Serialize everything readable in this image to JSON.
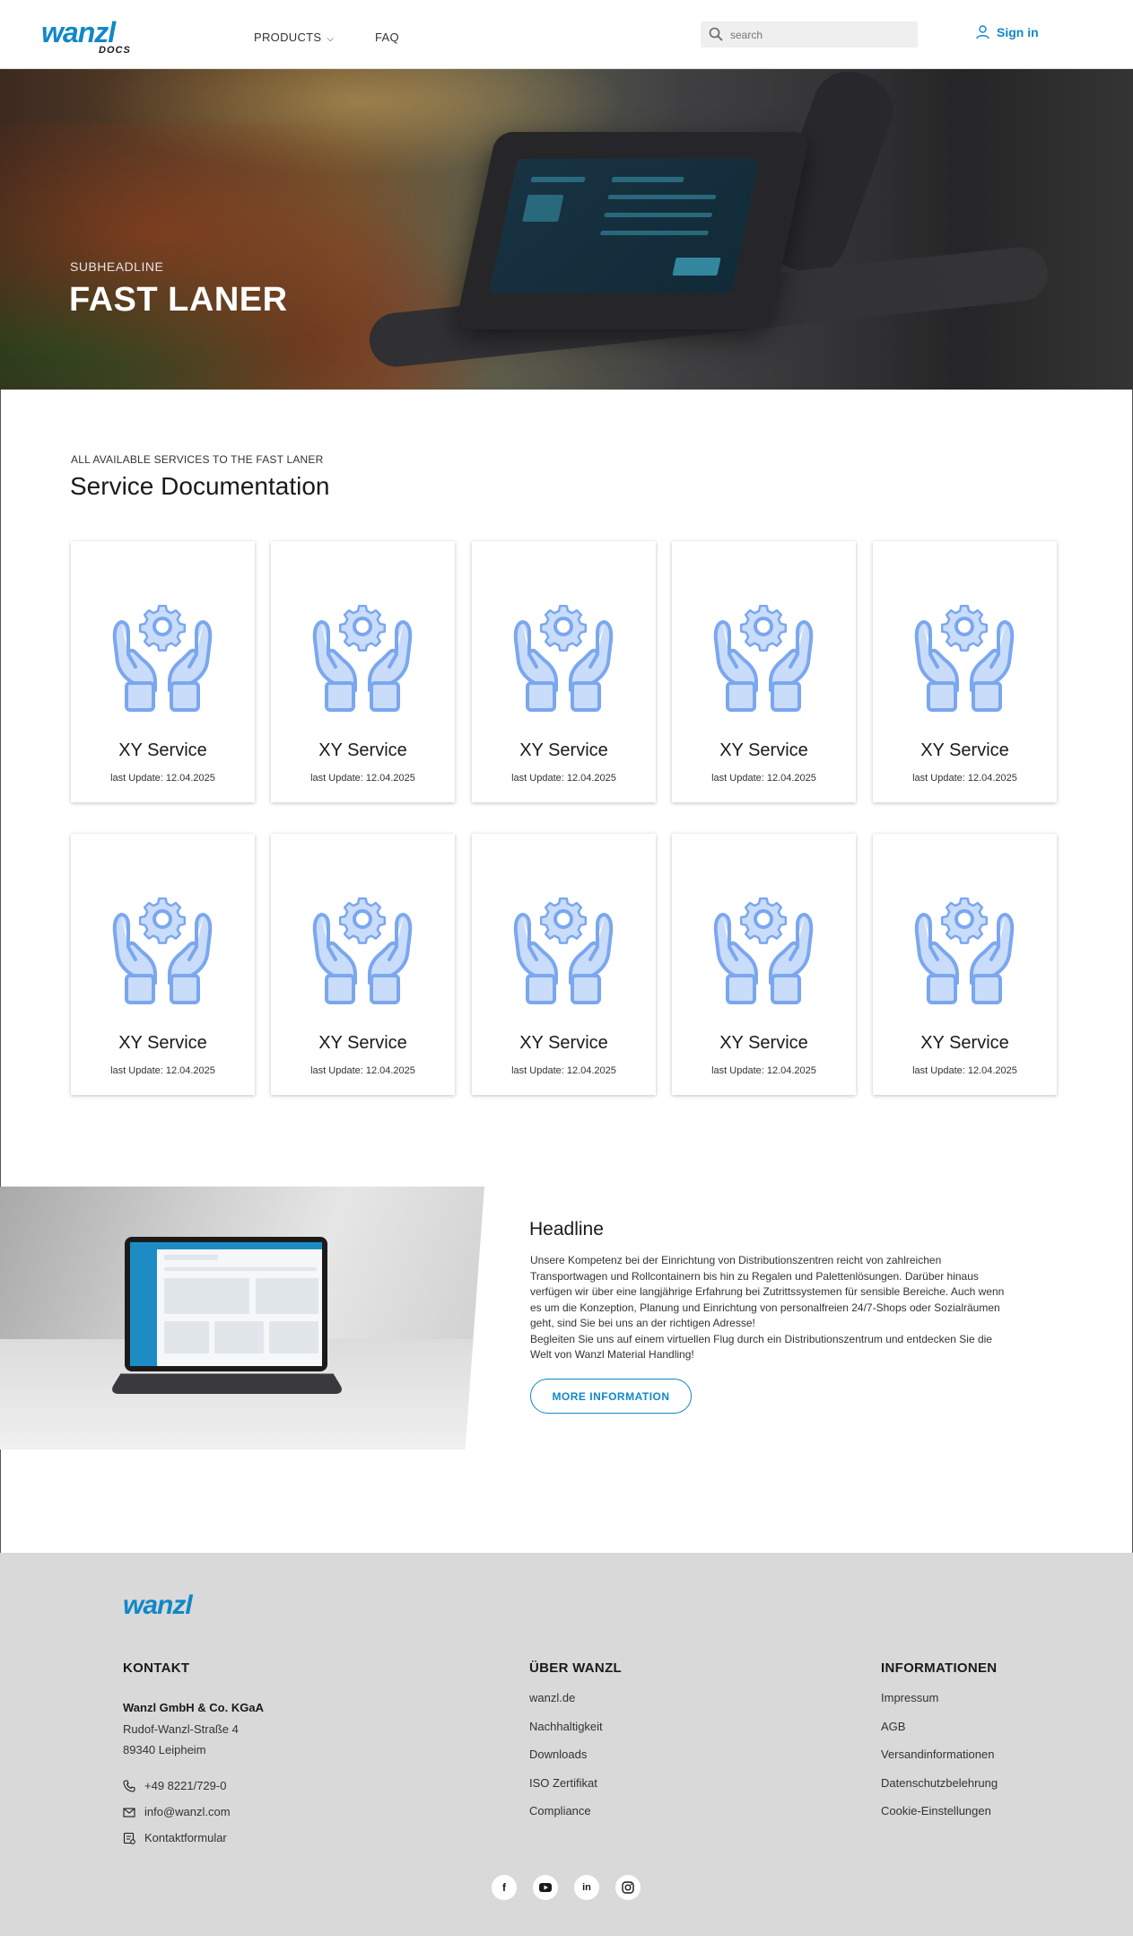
{
  "header": {
    "logo": "wanzl",
    "logo_sub": "DOCS",
    "nav": {
      "products": "PRODUCTS",
      "faq": "FAQ"
    },
    "search_placeholder": "search",
    "signin": "Sign in"
  },
  "hero": {
    "subheadline": "SUBHEADLINE",
    "title": "FAST LANER"
  },
  "services": {
    "subheading": "ALL AVAILABLE SERVICES TO THE FAST LANER",
    "title": "Service Documentation",
    "cards": [
      {
        "title": "XY Service",
        "date": "last Update: 12.04.2025"
      },
      {
        "title": "XY Service",
        "date": "last Update: 12.04.2025"
      },
      {
        "title": "XY Service",
        "date": "last Update: 12.04.2025"
      },
      {
        "title": "XY Service",
        "date": "last Update: 12.04.2025"
      },
      {
        "title": "XY Service",
        "date": "last Update: 12.04.2025"
      },
      {
        "title": "XY Service",
        "date": "last Update: 12.04.2025"
      },
      {
        "title": "XY Service",
        "date": "last Update: 12.04.2025"
      },
      {
        "title": "XY Service",
        "date": "last Update: 12.04.2025"
      },
      {
        "title": "XY Service",
        "date": "last Update: 12.04.2025"
      },
      {
        "title": "XY Service",
        "date": "last Update: 12.04.2025"
      }
    ]
  },
  "info": {
    "headline": "Headline",
    "body1": "Unsere Kompetenz bei der Einrichtung von Distributionszentren reicht von zahlreichen Transportwagen und Rollcontainern bis hin zu Regalen und Palettenlösungen. Darüber hinaus verfügen wir über eine langjährige Erfahrung bei Zutrittssystemen für sensible Bereiche. Auch wenn es um die Konzeption, Planung und Einrichtung von personalfreien 24/7-Shops oder Sozialräumen geht, sind Sie bei uns an der richtigen Adresse!",
    "body2": "Begleiten Sie uns auf einem virtuellen Flug durch ein Distributionszentrum und entdecken Sie die Welt von Wanzl Material Handling!",
    "button": "MORE INFORMATION"
  },
  "footer": {
    "logo": "wanzl",
    "kontakt": {
      "heading": "KONTAKT",
      "company": "Wanzl GmbH & Co. KGaA",
      "street": "Rudof-Wanzl-Straße 4",
      "city": "89340 Leipheim",
      "phone": "+49 8221/729-0",
      "email": "info@wanzl.com",
      "form": "Kontaktformular"
    },
    "uber": {
      "heading": "ÜBER WANZL",
      "links": [
        "wanzl.de",
        "Nachhaltigkeit",
        "Downloads",
        "ISO Zertifikat",
        "Compliance"
      ]
    },
    "informationen": {
      "heading": "INFORMATIONEN",
      "links": [
        "Impressum",
        "AGB",
        "Versandinformationen",
        "Datenschutzbelehrung",
        "Cookie-Einstellungen"
      ]
    },
    "social": [
      "facebook-icon",
      "youtube-icon",
      "linkedin-icon",
      "instagram-icon"
    ]
  },
  "colors": {
    "brand": "#1088c8",
    "icon_blue": "#8ab4f0",
    "footer_bg": "#d9d9d9"
  }
}
